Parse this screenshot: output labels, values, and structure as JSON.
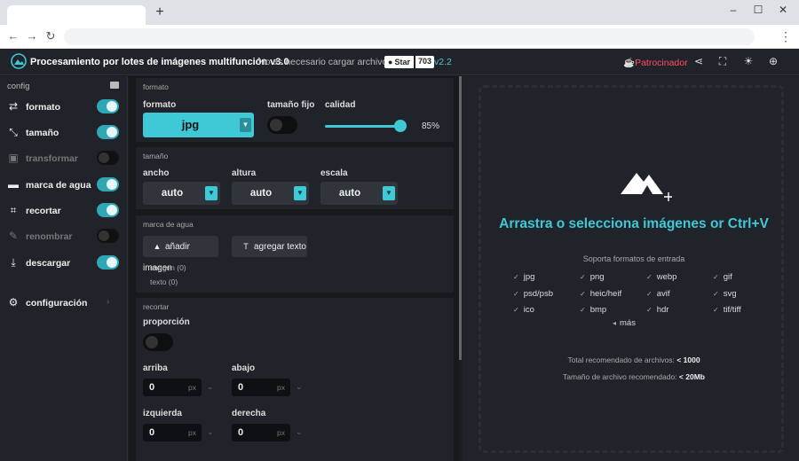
{
  "browser": {
    "new_tab": "+",
    "win_min": "–",
    "win_max": "☐",
    "win_close": "✕",
    "back": "←",
    "forward": "→",
    "reload": "↻",
    "menu": "⋮"
  },
  "header": {
    "title": "Procesamiento por lotes de imágenes multifunción v3.0",
    "subtitle": "No es necesario cargar archivos",
    "star_label": "Star",
    "star_count": "703",
    "version": "v2.2",
    "sponsor": "Patrocinador",
    "icons": [
      "share-icon",
      "screenshot-icon",
      "theme-icon",
      "language-icon"
    ]
  },
  "sidebar": {
    "heading": "config",
    "items": [
      {
        "label": "formato",
        "on": true
      },
      {
        "label": "tamaño",
        "on": true
      },
      {
        "label": "transformar",
        "on": false
      },
      {
        "label": "marca de agua",
        "on": true
      },
      {
        "label": "recortar",
        "on": true
      },
      {
        "label": "renombrar",
        "on": false
      },
      {
        "label": "descargar",
        "on": true
      }
    ],
    "config_label": "configuración"
  },
  "formato": {
    "section": "formato",
    "format_label": "formato",
    "format_value": "jpg",
    "fixed_label": "tamaño fijo",
    "quality_label": "calidad",
    "quality_value": "85%",
    "quality": 85
  },
  "tamano": {
    "section": "tamaño",
    "width_label": "ancho",
    "width_value": "auto",
    "height_label": "altura",
    "height_value": "auto",
    "scale_label": "escala",
    "scale_value": "auto"
  },
  "marca": {
    "section": "marca de agua",
    "add_image": "añadir imagen",
    "add_text": "agregar texto",
    "image_count": "imagen (0)",
    "text_count": "texto (0)"
  },
  "recortar": {
    "section": "recortar",
    "proportion_label": "proporción",
    "top_label": "arriba",
    "top_value": "0",
    "bottom_label": "abajo",
    "bottom_value": "0",
    "left_label": "izquierda",
    "left_value": "0",
    "right_label": "derecha",
    "right_value": "0",
    "unit": "px"
  },
  "dropzone": {
    "title": "Arrastra o selecciona imágenes or Ctrl+V",
    "formats_title": "Soporta formatos de entrada",
    "formats": [
      "jpg",
      "png",
      "webp",
      "gif",
      "psd/psb",
      "heic/heif",
      "avif",
      "svg",
      "ico",
      "bmp",
      "hdr",
      "tif/tiff"
    ],
    "more": "más",
    "total_label": "Total recomendado de archivos:",
    "total_value": "< 1000",
    "size_label": "Tamaño de archivo recomendado:",
    "size_value": "< 20Mb"
  },
  "colors": {
    "accent": "#3fc8d6",
    "sponsor": "#ff4e6b",
    "panel": "#202329",
    "background": "#17191d"
  }
}
